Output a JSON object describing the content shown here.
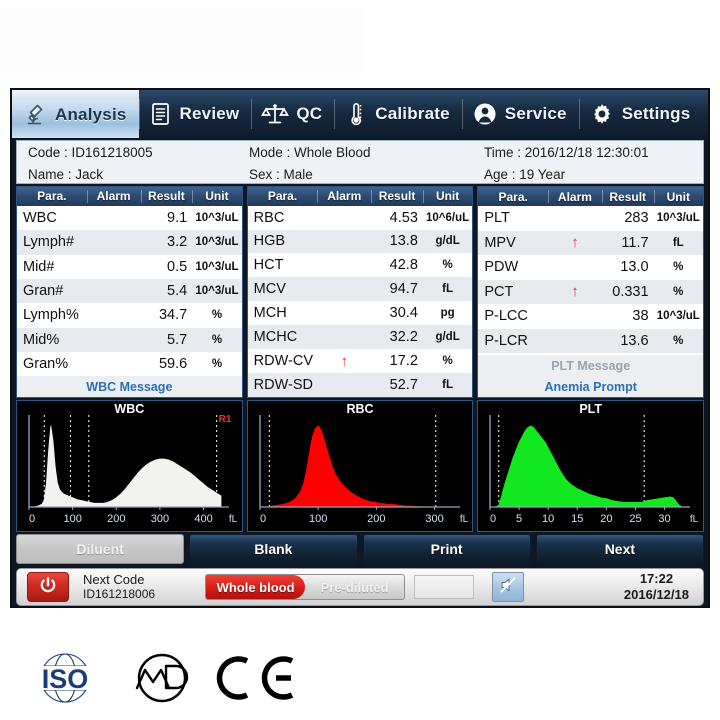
{
  "tabs": [
    {
      "label": "Analysis",
      "icon": "microscope-icon",
      "active": true
    },
    {
      "label": "Review",
      "icon": "document-icon",
      "active": false
    },
    {
      "label": "QC",
      "icon": "balance-scale-icon",
      "active": false
    },
    {
      "label": "Calibrate",
      "icon": "thermometer-icon",
      "active": false
    },
    {
      "label": "Service",
      "icon": "person-icon",
      "active": false
    },
    {
      "label": "Settings",
      "icon": "gear-icon",
      "active": false
    }
  ],
  "patient": {
    "code_label": "Code : ID161218005",
    "mode_label": "Mode : Whole Blood",
    "time_label": "Time : 2016/12/18 12:30:01",
    "name_label": "Name : Jack",
    "sex_label": "Sex : Male",
    "age_label": "Age : 19 Year"
  },
  "table_headers": [
    "Para.",
    "Alarm",
    "Result",
    "Unit"
  ],
  "tables": [
    {
      "name": "wbc-table",
      "rows": [
        {
          "para": "WBC",
          "alarm": "",
          "result": "9.1",
          "unit": "10^3/uL"
        },
        {
          "para": "Lymph#",
          "alarm": "",
          "result": "3.2",
          "unit": "10^3/uL"
        },
        {
          "para": "Mid#",
          "alarm": "",
          "result": "0.5",
          "unit": "10^3/uL"
        },
        {
          "para": "Gran#",
          "alarm": "",
          "result": "5.4",
          "unit": "10^3/uL"
        },
        {
          "para": "Lymph%",
          "alarm": "",
          "result": "34.7",
          "unit": "%"
        },
        {
          "para": "Mid%",
          "alarm": "",
          "result": "5.7",
          "unit": "%"
        },
        {
          "para": "Gran%",
          "alarm": "",
          "result": "59.6",
          "unit": "%"
        }
      ],
      "messages": [
        {
          "text": "WBC Message",
          "style": "blue"
        }
      ]
    },
    {
      "name": "rbc-table",
      "rows": [
        {
          "para": "RBC",
          "alarm": "",
          "result": "4.53",
          "unit": "10^6/uL"
        },
        {
          "para": "HGB",
          "alarm": "",
          "result": "13.8",
          "unit": "g/dL"
        },
        {
          "para": "HCT",
          "alarm": "",
          "result": "42.8",
          "unit": "%"
        },
        {
          "para": "MCV",
          "alarm": "",
          "result": "94.7",
          "unit": "fL"
        },
        {
          "para": "MCH",
          "alarm": "",
          "result": "30.4",
          "unit": "pg"
        },
        {
          "para": "MCHC",
          "alarm": "",
          "result": "32.2",
          "unit": "g/dL"
        },
        {
          "para": "RDW-CV",
          "alarm": "high",
          "result": "17.2",
          "unit": "%"
        },
        {
          "para": "RDW-SD",
          "alarm": "",
          "result": "52.7",
          "unit": "fL"
        }
      ],
      "messages": []
    },
    {
      "name": "plt-table",
      "rows": [
        {
          "para": "PLT",
          "alarm": "",
          "result": "283",
          "unit": "10^3/uL"
        },
        {
          "para": "MPV",
          "alarm": "high",
          "result": "11.7",
          "unit": "fL"
        },
        {
          "para": "PDW",
          "alarm": "",
          "result": "13.0",
          "unit": "%"
        },
        {
          "para": "PCT",
          "alarm": "high",
          "result": "0.331",
          "unit": "%"
        },
        {
          "para": "P-LCC",
          "alarm": "",
          "result": "38",
          "unit": "10^3/uL"
        },
        {
          "para": "P-LCR",
          "alarm": "",
          "result": "13.6",
          "unit": "%"
        }
      ],
      "messages": [
        {
          "text": "PLT Message",
          "style": "gray"
        },
        {
          "text": "Anemia Prompt",
          "style": "blue"
        }
      ]
    }
  ],
  "chart_data": [
    {
      "type": "area",
      "name": "wbc-histogram",
      "title": "WBC",
      "color": "#f2f2ee",
      "xlabel": "fL",
      "ticks": [
        0,
        100,
        200,
        300,
        400
      ],
      "xlim": [
        0,
        440
      ],
      "discriminators": [
        35,
        95,
        137,
        430
      ],
      "flag": "R1",
      "x": [
        0,
        10,
        20,
        30,
        35,
        40,
        45,
        50,
        55,
        60,
        65,
        70,
        75,
        80,
        90,
        100,
        110,
        120,
        130,
        140,
        150,
        160,
        170,
        180,
        190,
        200,
        210,
        220,
        230,
        240,
        250,
        260,
        270,
        280,
        290,
        300,
        310,
        320,
        330,
        340,
        350,
        360,
        370,
        380,
        390,
        400,
        410,
        420,
        430,
        440
      ],
      "y": [
        0,
        0,
        1,
        3,
        8,
        26,
        62,
        88,
        72,
        44,
        26,
        19,
        16,
        14,
        12,
        10,
        8,
        7,
        6,
        5,
        4,
        4,
        4,
        5,
        7,
        10,
        14,
        19,
        25,
        31,
        37,
        42,
        46,
        49,
        51,
        52,
        52,
        51,
        49,
        46,
        43,
        40,
        37,
        33,
        29,
        25,
        21,
        18,
        15,
        12
      ]
    },
    {
      "type": "area",
      "name": "rbc-histogram",
      "title": "RBC",
      "color": "#ff0000",
      "xlabel": "fL",
      "ticks": [
        0,
        100,
        200,
        300
      ],
      "xlim": [
        0,
        330
      ],
      "discriminators": [
        16,
        302
      ],
      "x": [
        0,
        10,
        20,
        30,
        40,
        50,
        60,
        70,
        75,
        80,
        85,
        90,
        95,
        100,
        105,
        110,
        115,
        120,
        125,
        130,
        140,
        150,
        160,
        170,
        180,
        190,
        200,
        210,
        220,
        230,
        240,
        250,
        260,
        280,
        300,
        320,
        330
      ],
      "y": [
        0,
        0,
        1,
        2,
        3,
        5,
        9,
        18,
        27,
        42,
        62,
        80,
        90,
        93,
        88,
        78,
        66,
        55,
        45,
        37,
        27,
        20,
        15,
        11,
        8,
        6,
        5,
        4,
        3,
        3,
        2,
        1,
        1,
        0,
        0,
        0,
        0
      ]
    },
    {
      "type": "area",
      "name": "plt-histogram",
      "title": "PLT",
      "color": "#12e81f",
      "xlabel": "fL",
      "ticks": [
        0,
        5,
        10,
        15,
        20,
        25,
        30
      ],
      "xlim": [
        0,
        33
      ],
      "discriminators": [
        1.5,
        26.5
      ],
      "x": [
        0,
        1,
        1.5,
        2,
        2.5,
        3,
        3.5,
        4,
        4.5,
        5,
        5.5,
        6,
        6.5,
        7,
        7.5,
        8,
        8.5,
        9,
        9.5,
        10,
        10.5,
        11,
        11.5,
        12,
        13,
        14,
        15,
        16,
        17,
        18,
        19,
        20,
        21,
        22,
        23,
        24,
        25,
        26,
        27,
        28,
        29,
        30,
        31,
        31.5,
        32,
        32.5,
        33
      ],
      "y": [
        0,
        0,
        2,
        12,
        24,
        34,
        44,
        54,
        62,
        70,
        76,
        82,
        86,
        88,
        86,
        82,
        78,
        74,
        70,
        64,
        58,
        52,
        46,
        40,
        30,
        24,
        20,
        17,
        14,
        12,
        10,
        9,
        7,
        6,
        5,
        5,
        5,
        5,
        7,
        8,
        9,
        10,
        11,
        10,
        6,
        2,
        0
      ]
    }
  ],
  "buttons": [
    {
      "label": "Diluent",
      "style": "gray"
    },
    {
      "label": "Blank",
      "style": "dark"
    },
    {
      "label": "Print",
      "style": "dark"
    },
    {
      "label": "Next",
      "style": "dark"
    }
  ],
  "statusbar": {
    "power_icon": "power-icon",
    "next_code_label": "Next Code",
    "next_code_value": "ID161218006",
    "mode_whole_blood": "Whole blood",
    "mode_pre_diluted": "Pre-diluted",
    "mute_icon": "mute-speaker-icon",
    "time": "17:22",
    "date": "2016/12/18"
  },
  "certs": [
    {
      "name": "iso-logo",
      "label": "ISO"
    },
    {
      "name": "md-logo",
      "label": "MD"
    },
    {
      "name": "ce-logo",
      "label": "CE"
    }
  ],
  "colors": {
    "accent": "#2f6fb5",
    "alarm_high": "#e8302a",
    "header_bg": "#2b4a70",
    "wbc": "#f2f2ee",
    "rbc": "#ff0000",
    "plt": "#12e81f"
  }
}
